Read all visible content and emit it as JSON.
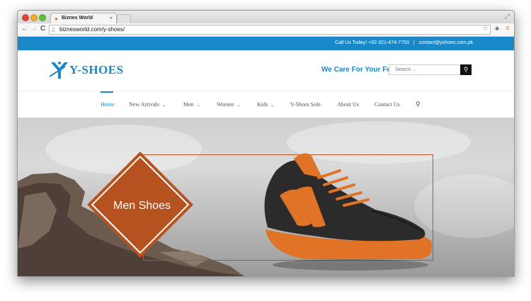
{
  "browser": {
    "tab_title": "Biznes World",
    "tab_favicon": "pin-icon",
    "tab_close": "×",
    "url": "biznesworld.com/y-shoes/",
    "back": "←",
    "forward": "→",
    "reload": "C",
    "star": "☆",
    "menu": "≡",
    "resize": "⤢"
  },
  "topbar": {
    "call_text": "Call Us Today! +92-321-474-7753",
    "separator": "|",
    "email": "contact@yshoes.com.pk",
    "bg_color": "#1a87c8"
  },
  "header": {
    "logo_text": "Y-SHOES",
    "tagline": "We Care For Your Feet",
    "search_placeholder": "Search ...",
    "search_icon": "search-icon"
  },
  "nav": {
    "items": [
      {
        "label": "Home",
        "active": true,
        "has_dropdown": false
      },
      {
        "label": "New Arrivals",
        "active": false,
        "has_dropdown": true
      },
      {
        "label": "Men",
        "active": false,
        "has_dropdown": true
      },
      {
        "label": "Women",
        "active": false,
        "has_dropdown": true
      },
      {
        "label": "Kids",
        "active": false,
        "has_dropdown": true
      },
      {
        "label": "Y-Shoes Sole",
        "active": false,
        "has_dropdown": false
      },
      {
        "label": "About Us",
        "active": false,
        "has_dropdown": false
      },
      {
        "label": "Contact Us",
        "active": false,
        "has_dropdown": false
      }
    ],
    "chevron": "⌄",
    "search_glyph": "⚲",
    "accent_color": "#1a87c8"
  },
  "hero": {
    "title": "Men Shoes",
    "accent_color": "#b6521f"
  }
}
